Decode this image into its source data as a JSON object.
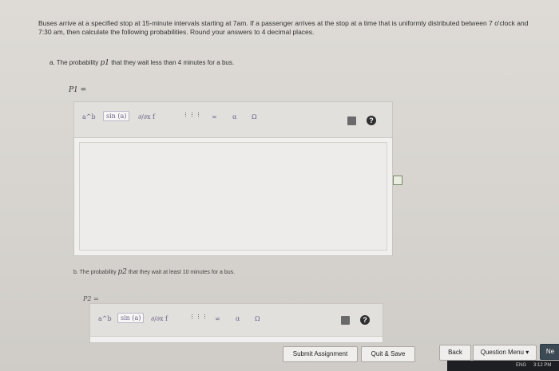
{
  "problem": {
    "text": "Buses arrive at a specified stop at 15-minute intervals starting at 7am. If a passenger arrives at the stop at a time that is uniformly distributed between 7 o'clock and 7:30 am, then calculate the following probabilities. Round your answers to 4 decimal places."
  },
  "partA": {
    "prefix": "a. The probability",
    "symbol": "p1",
    "suffix": "that they wait less than 4 minutes for a bus.",
    "answer_label": "P1 ="
  },
  "partB": {
    "prefix": "b. The probability",
    "symbol": "p2",
    "suffix": "that they wait at least 10 minutes for a bus.",
    "answer_label": "P2 ="
  },
  "toolbar": {
    "power": "a^b",
    "sin": "sin (a)",
    "derivative": "∂/∂x f",
    "matrix": "⋮⋮⋮",
    "infinity": "∞",
    "alpha": "α",
    "omega": "Ω",
    "help": "?"
  },
  "buttons": {
    "submit": "Submit Assignment",
    "quit": "Quit & Save",
    "back": "Back",
    "question_menu": "Question Menu ▾",
    "next": "Ne"
  },
  "taskbar": {
    "lang": "ENG",
    "time": "3:12 PM"
  }
}
